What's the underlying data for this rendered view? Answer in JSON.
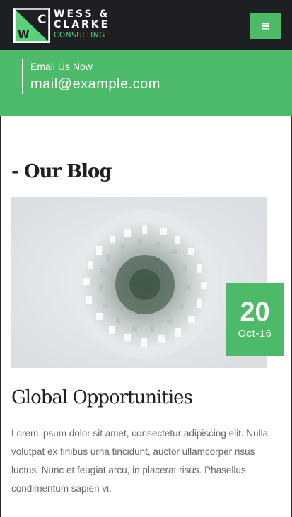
{
  "brand": {
    "line1": "WESS &",
    "line2": "CLARKE",
    "line3": "CONSULTING",
    "mark_letters": [
      "C",
      "W"
    ],
    "accent_color": "#4cba68",
    "header_color": "#1e1f23"
  },
  "header": {
    "menu_icon": "hamburger-icon"
  },
  "contact": {
    "label": "Email Us Now",
    "email": "mail@example.com"
  },
  "blog": {
    "section_title": "- Our Blog",
    "post": {
      "date_day": "20",
      "date_month": "Oct-16",
      "title": "Global Opportunities",
      "excerpt": "Lorem ipsum dolor sit amet, consectetur adipiscing elit. Nulla volutpat ex finibus urna tincidunt, auctor ullamcorper risus luctus. Nunc et feugiat arcu, in placerat risus. Phasellus condimentum sapien vi."
    }
  }
}
